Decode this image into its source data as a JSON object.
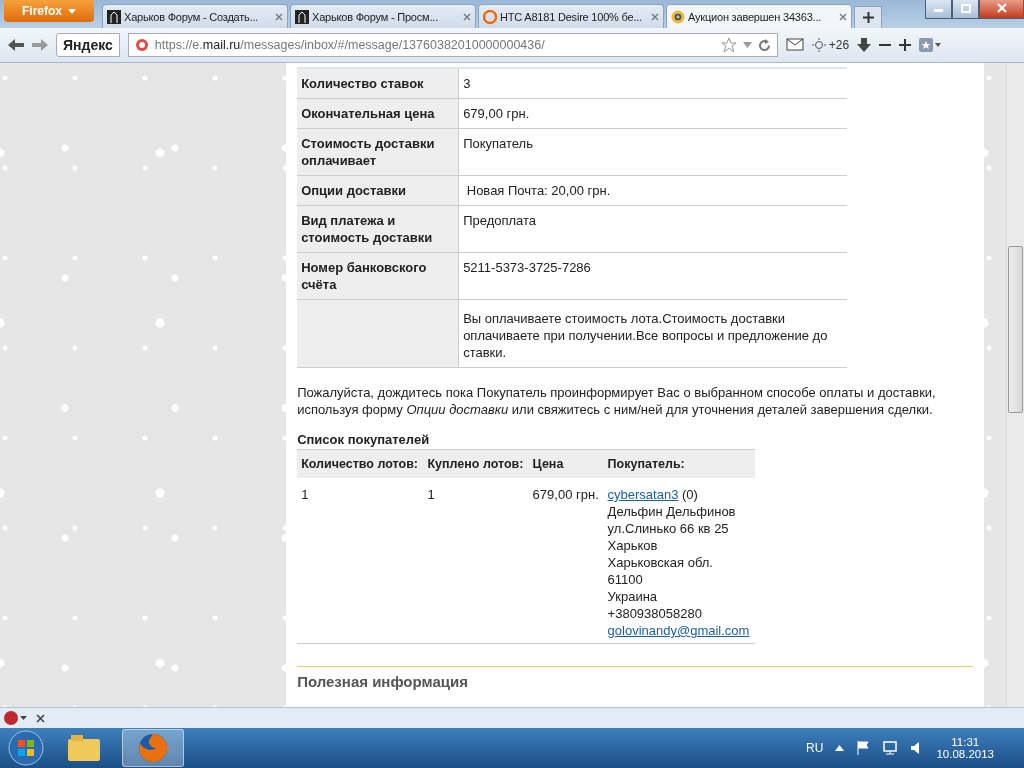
{
  "browser": {
    "menu_button": "Firefox",
    "tabs": [
      {
        "kind": "forum",
        "label": "Харьков Форум - Создать...",
        "selected": false
      },
      {
        "kind": "forum",
        "label": "Харьков Форум - Просм...",
        "selected": false
      },
      {
        "kind": "shop",
        "label": "HTC A8181 Desire 100% бе...",
        "selected": false
      },
      {
        "kind": "mail",
        "label": "Аукцион завершен 34363...",
        "selected": true
      }
    ],
    "search_brand": "Яндекс",
    "url_prefix": "https://e.",
    "url_host": "mail.ru",
    "url_path": "/messages/inbox/#/message/13760382010000000436/",
    "counter": "+26"
  },
  "details": [
    {
      "label": "Количество ставок",
      "value": "3"
    },
    {
      "label": "Окончательная цена",
      "value": "679,00 грн."
    },
    {
      "label": "Стоимость доставки оплачивает",
      "value": "Покупатель"
    },
    {
      "label": "Опции доставки",
      "value": " Новая Почта: 20,00 грн."
    },
    {
      "label": "Вид платежа и стоимость доставки",
      "value": "Предоплата"
    },
    {
      "label": "Номер банковского счёта",
      "value": "5211-5373-3725-7286"
    },
    {
      "value": "Вы оплачиваете стоимость лота.Стоимость доставки оплачиваете при получении.Все вопросы и предложение до ставки."
    }
  ],
  "notice": "Пожалуйста, дождитесь пока Покупатель проинформирует Вас о выбранном способе оплаты и доставки, используя форму *Опции доставки* или свяжитесь с ним/ней для уточнения деталей завершения сделки.",
  "buyers": {
    "title": "Список покупателей",
    "columns": [
      "Количество лотов:",
      "Куплено лотов:",
      "Цена",
      "Покупатель:"
    ],
    "rows": [
      {
        "lots": "1",
        "bought": "1",
        "price": "679,00 грн.",
        "nick": "cybersatan3",
        "rating": "(0)",
        "lines": [
          "Дельфин Дельфинов",
          "ул.Слинько 66 кв 25",
          "Харьков",
          "Харьковская обл.",
          "61100",
          "Украина",
          "+380938058280"
        ],
        "email": "golovinandy@gmail.com"
      }
    ]
  },
  "section_heading": "Полезная информация",
  "taskbar": {
    "language": "RU",
    "time": "11:31",
    "date": "10.08.2013"
  }
}
